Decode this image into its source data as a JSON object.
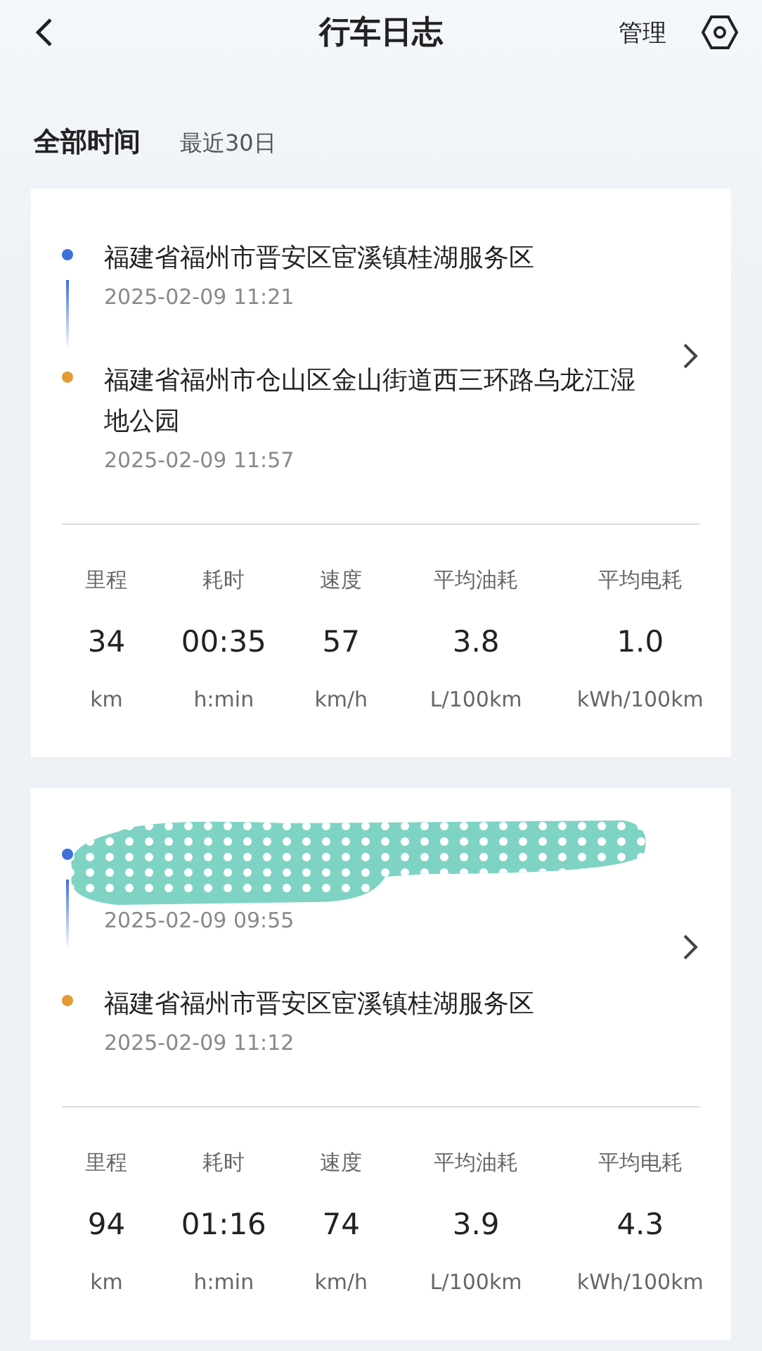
{
  "header": {
    "title": "行车日志",
    "action": "管理"
  },
  "filter": {
    "range": "全部时间",
    "period": "最近30日"
  },
  "trips": [
    {
      "stops": [
        {
          "kind": "start",
          "address": "福建省福州市晋安区宦溪镇桂湖服务区",
          "time": "2025-02-09 11:21"
        },
        {
          "kind": "end",
          "address": "福建省福州市仓山区金山街道西三环路乌龙江湿地公园",
          "time": "2025-02-09 11:57"
        }
      ],
      "stats": [
        {
          "label": "里程",
          "value": "34",
          "unit": "km"
        },
        {
          "label": "耗时",
          "value": "00:35",
          "unit": "h:min"
        },
        {
          "label": "速度",
          "value": "57",
          "unit": "km/h"
        },
        {
          "label": "平均油耗",
          "value": "3.8",
          "unit": "L/100km"
        },
        {
          "label": "平均电耗",
          "value": "1.0",
          "unit": "kWh/100km"
        }
      ]
    },
    {
      "stops": [
        {
          "kind": "start",
          "redacted": true,
          "time": "2025-02-09 09:55"
        },
        {
          "kind": "end",
          "address": "福建省福州市晋安区宦溪镇桂湖服务区",
          "time": "2025-02-09 11:12"
        }
      ],
      "stats": [
        {
          "label": "里程",
          "value": "94",
          "unit": "km"
        },
        {
          "label": "耗时",
          "value": "01:16",
          "unit": "h:min"
        },
        {
          "label": "速度",
          "value": "74",
          "unit": "km/h"
        },
        {
          "label": "平均油耗",
          "value": "3.9",
          "unit": "L/100km"
        },
        {
          "label": "平均电耗",
          "value": "4.3",
          "unit": "kWh/100km"
        }
      ]
    }
  ]
}
